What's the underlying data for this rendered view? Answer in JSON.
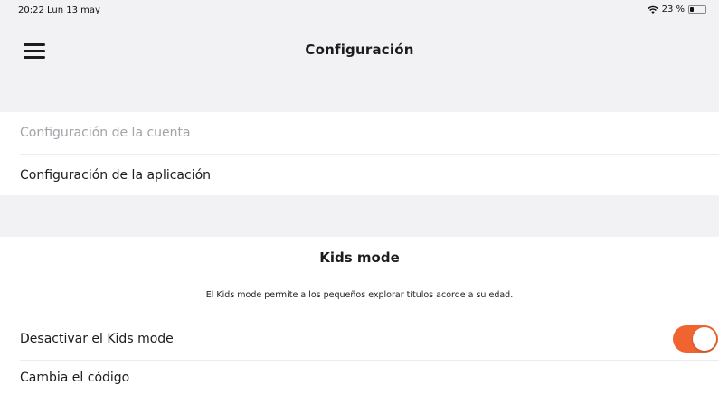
{
  "status_bar": {
    "time": "20:22  Lun 13 may",
    "battery": "23 %"
  },
  "nav": {
    "menu_icon": "hamburger-icon",
    "title": "Configuración"
  },
  "settings": {
    "account": "Configuración de la cuenta",
    "app": "Configuración de la aplicación"
  },
  "kids_mode": {
    "title": "Kids mode",
    "description": "El Kids mode permite a los pequeños explorar títulos acorde a su edad.",
    "toggle_label": "Desactivar el Kids mode",
    "toggle_on": true,
    "change_code": "Cambia el código"
  },
  "colors": {
    "accent": "#f0642f",
    "background": "#f2f2f4"
  }
}
